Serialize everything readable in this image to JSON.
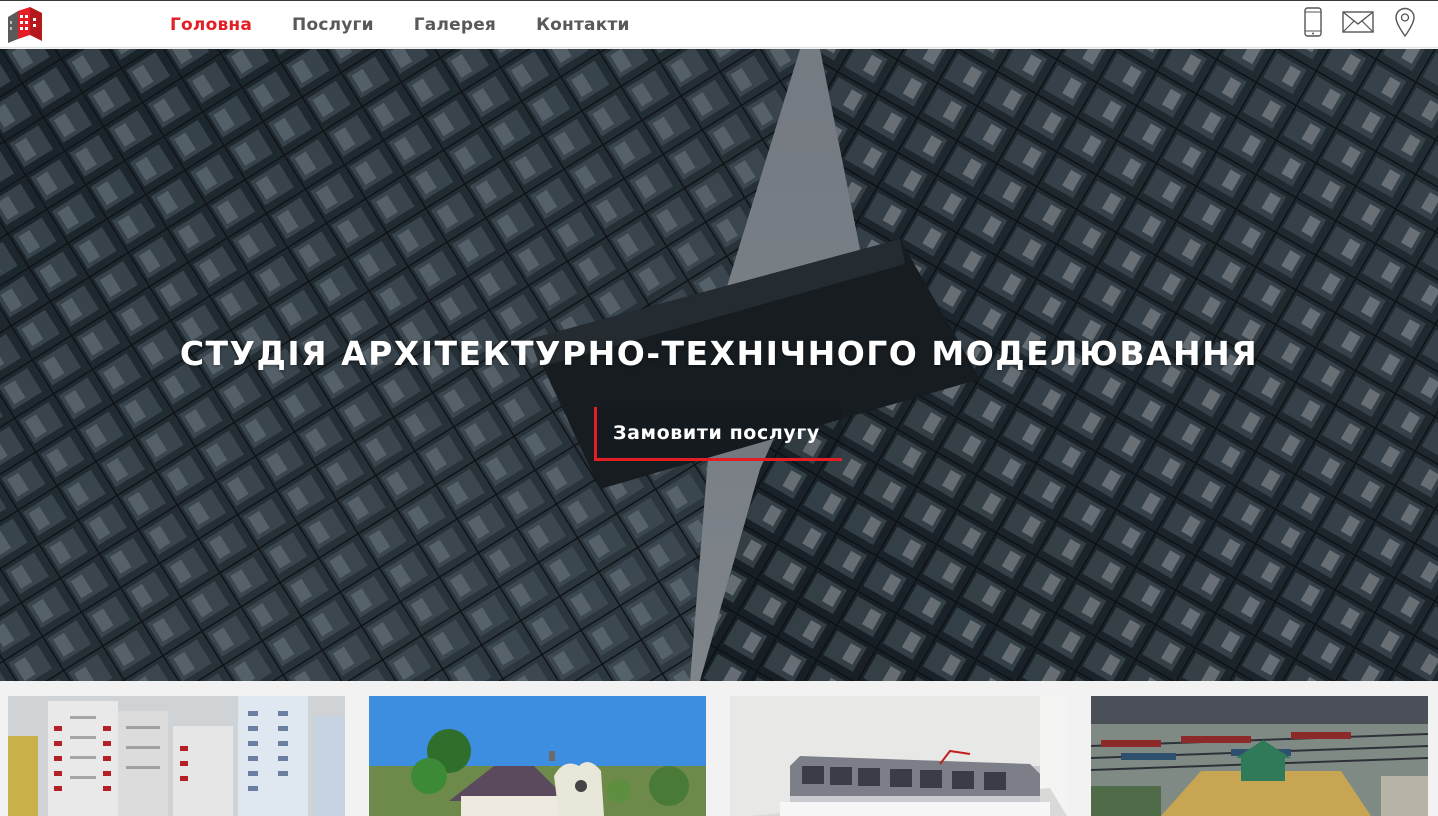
{
  "header": {
    "nav": [
      {
        "label": "Головна",
        "active": true
      },
      {
        "label": "Послуги",
        "active": false
      },
      {
        "label": "Галерея",
        "active": false
      },
      {
        "label": "Контакти",
        "active": false
      }
    ],
    "icons": [
      "logo-icon",
      "phone-icon",
      "mail-icon",
      "location-pin-icon"
    ]
  },
  "hero": {
    "title": "СТУДІЯ АРХІТЕКТУРНО-ТЕХНІЧНОГО МОДЕЛЮВАННЯ",
    "cta_label": "Замовити послугу"
  },
  "gallery": {
    "thumbnails": [
      "high-rise-model-photo",
      "house-model-photo",
      "tram-model-photo",
      "railway-station-model-photo"
    ]
  },
  "colors": {
    "accent": "#e31e24",
    "nav_text": "#595959",
    "hero_text": "#ffffff",
    "hero_bg": "#4b5660"
  }
}
